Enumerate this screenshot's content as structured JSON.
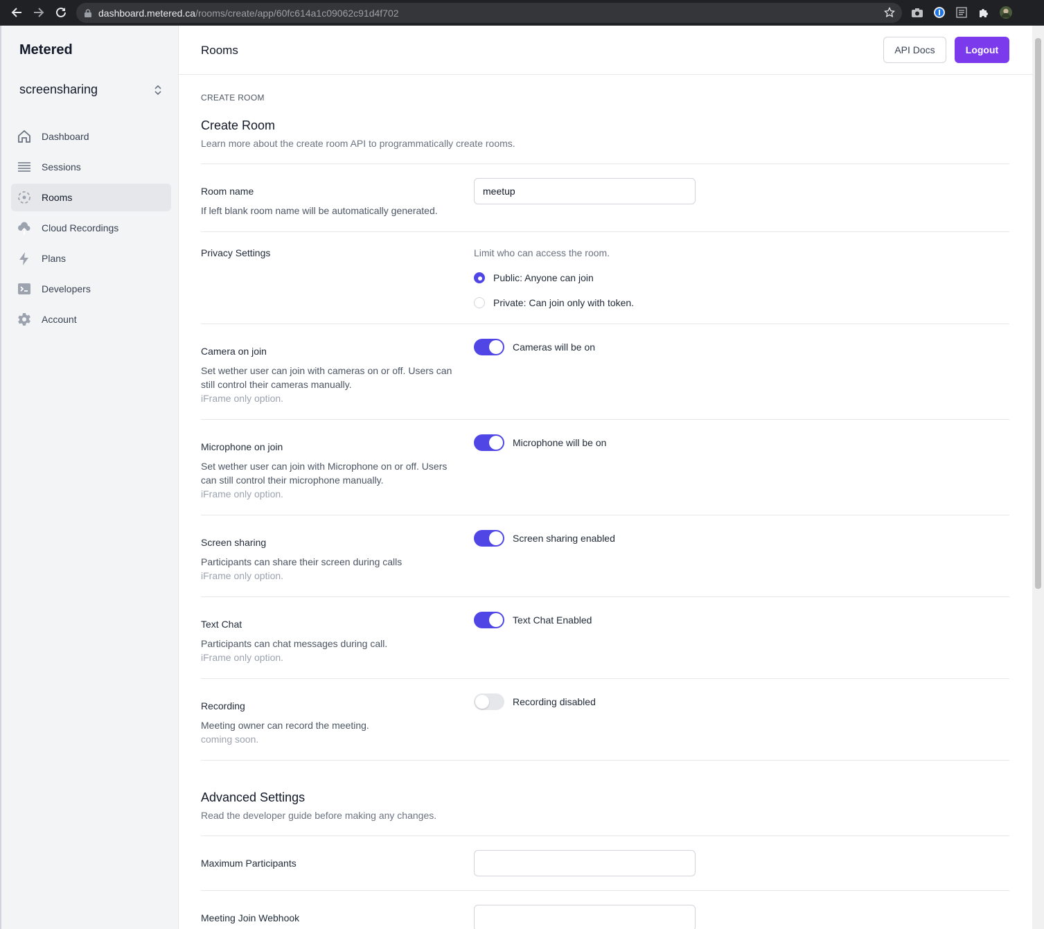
{
  "browser": {
    "url_host": "dashboard.metered.ca",
    "url_path": "/rooms/create/app/60fc614a1c09062c91d4f702"
  },
  "sidebar": {
    "brand": "Metered",
    "app_name": "screensharing",
    "items": [
      {
        "label": "Dashboard",
        "icon": "home-icon"
      },
      {
        "label": "Sessions",
        "icon": "menu-lines-icon"
      },
      {
        "label": "Rooms",
        "icon": "rooms-icon",
        "active": true
      },
      {
        "label": "Cloud Recordings",
        "icon": "cloud-upload-icon"
      },
      {
        "label": "Plans",
        "icon": "lightning-icon"
      },
      {
        "label": "Developers",
        "icon": "terminal-icon"
      },
      {
        "label": "Account",
        "icon": "gear-icon"
      }
    ]
  },
  "header": {
    "title": "Rooms",
    "api_docs": "API Docs",
    "logout": "Logout"
  },
  "colors": {
    "accent": "#4f46e5",
    "logout": "#7c3aed"
  },
  "main": {
    "eyebrow": "CREATE ROOM",
    "title": "Create Room",
    "subtitle": "Learn more about the create room API to programmatically create rooms.",
    "room_name": {
      "label": "Room name",
      "desc": "If left blank room name will be automatically generated.",
      "value": "meetup"
    },
    "privacy": {
      "label": "Privacy Settings",
      "hint": "Limit who can access the room.",
      "public": "Public: Anyone can join",
      "private": "Private: Can join only with token.",
      "selected": "public"
    },
    "camera": {
      "label": "Camera on join",
      "desc": "Set wether user can join with cameras on or off. Users can still control their cameras manually.",
      "note": "iFrame only option.",
      "toggle_label": "Cameras will be on",
      "on": true
    },
    "microphone": {
      "label": "Microphone on join",
      "desc": "Set wether user can join with Microphone on or off. Users can still control their microphone manually.",
      "note": "iFrame only option.",
      "toggle_label": "Microphone will be on",
      "on": true
    },
    "screen": {
      "label": "Screen sharing",
      "desc": "Participants can share their screen during calls",
      "note": "iFrame only option.",
      "toggle_label": "Screen sharing enabled",
      "on": true
    },
    "chat": {
      "label": "Text Chat",
      "desc": "Participants can chat messages during call.",
      "note": "iFrame only option.",
      "toggle_label": "Text Chat Enabled",
      "on": true
    },
    "recording": {
      "label": "Recording",
      "desc": "Meeting owner can record the meeting.",
      "note": "coming soon.",
      "toggle_label": "Recording disabled",
      "on": false
    },
    "advanced": {
      "title": "Advanced Settings",
      "subtitle": "Read the developer guide before making any changes.",
      "max_participants": {
        "label": "Maximum Participants",
        "value": ""
      },
      "join_webhook": {
        "label": "Meeting Join Webhook",
        "value": ""
      }
    }
  }
}
